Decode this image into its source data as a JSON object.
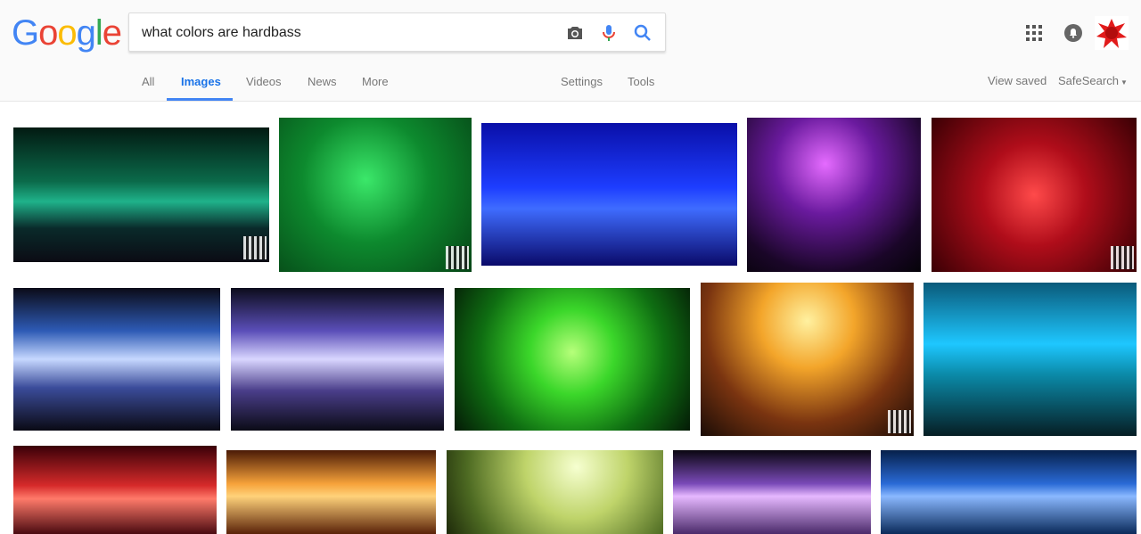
{
  "logo": {
    "letters": [
      "G",
      "o",
      "o",
      "g",
      "l",
      "e"
    ]
  },
  "search": {
    "query": "what colors are hardbass"
  },
  "tabs": {
    "all": "All",
    "images": "Images",
    "videos": "Videos",
    "news": "News",
    "more": "More",
    "settings": "Settings",
    "tools": "Tools"
  },
  "right": {
    "view_saved": "View saved",
    "safesearch": "SafeSearch"
  },
  "colors": {
    "google_blue": "#4285f4",
    "google_red": "#ea4335",
    "google_yellow": "#fbbc05",
    "google_green": "#34a853",
    "accent": "#1a73e8"
  },
  "images": [
    {
      "label": "green stage lasers",
      "bg": "linear-gradient(180deg,#021a12 0%,#0b6a4a 40%,#1fb28a 55%,#0a2a2a 75%,#0b0b14 100%)"
    },
    {
      "label": "team green poster",
      "bg": "radial-gradient(circle at 45% 40%,#3be86a 0%,#0d8a2e 45%,#064416 100%)"
    },
    {
      "label": "blue stage",
      "bg": "linear-gradient(180deg,#0a0fa8 0%,#1d3dff 45%,#3f6cff 60%,#0a0a6a 100%)"
    },
    {
      "label": "purple lasers",
      "bg": "radial-gradient(circle at 45% 30%,#e56bff 0%,#6a1a9e 35%,#1a0628 75%,#050308 100%)"
    },
    {
      "label": "red stage",
      "bg": "radial-gradient(circle at 50% 50%,#ff4a4a 0%,#b00d1a 40%,#3a0004 100%)"
    },
    {
      "label": "light blue stage 1",
      "bg": "linear-gradient(180deg,#0b0b18 0%,#2d5ab5 30%,#c6d8ff 50%,#3b4c9a 70%,#0a0a14 100%)"
    },
    {
      "label": "light blue stage 2",
      "bg": "linear-gradient(180deg,#0c0c1c 0%,#5a4eb8 30%,#d9d6ff 50%,#4a3e8a 72%,#0b0b16 100%)"
    },
    {
      "label": "green stage crowd",
      "bg": "radial-gradient(circle at 50% 45%,#b6ff7a 0%,#3bd72a 30%,#0f6e12 65%,#041a06 100%)"
    },
    {
      "label": "orange stage",
      "bg": "radial-gradient(circle at 50% 25%,#fff1a0 0%,#f3a52a 30%,#7a3410 65%,#1a0c06 100%)"
    },
    {
      "label": "cyan lasers",
      "bg": "linear-gradient(180deg,#0a5a7a 0%,#1ec7ff 40%,#0b8aa8 60%,#061e24 100%)"
    },
    {
      "label": "red lights",
      "bg": "linear-gradient(180deg,#3a0008 0%,#d62a2a 45%,#ff7a6a 60%,#4a0a10 100%)"
    },
    {
      "label": "orange grid",
      "bg": "linear-gradient(180deg,#4a1a06 0%,#f6a23a 40%,#ffd27a 55%,#5a2208 100%)"
    },
    {
      "label": "yellow-green haze",
      "bg": "radial-gradient(circle at 60% 20%,#f6ffd0 0%,#bfd46a 35%,#4d6a22 75%,#1e2a0a 100%)"
    },
    {
      "label": "purple stage",
      "bg": "linear-gradient(180deg,#0a0610 0%,#7a4ab8 40%,#e6b8ff 55%,#4a2a6a 100%)"
    },
    {
      "label": "blue dj booth",
      "bg": "linear-gradient(180deg,#06204a 0%,#2a6ad6 40%,#8ab8ff 55%,#0a2a5a 100%)"
    }
  ]
}
